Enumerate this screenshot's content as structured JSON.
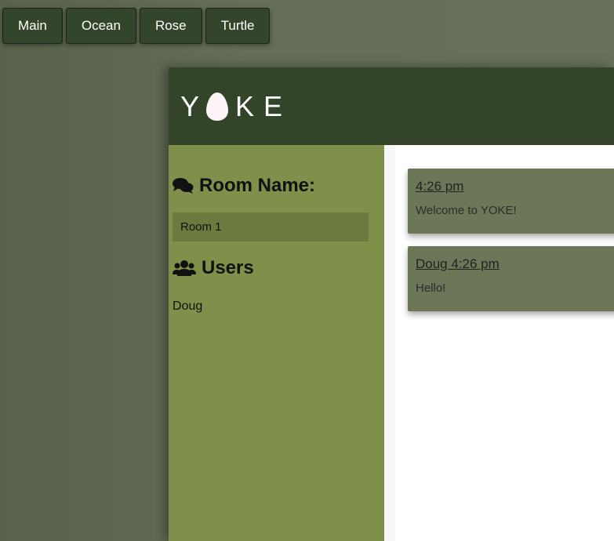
{
  "theme_buttons": [
    "Main",
    "Ocean",
    "Rose",
    "Turtle"
  ],
  "logo": {
    "letters": [
      "Y",
      "K",
      "E"
    ]
  },
  "sidebar": {
    "room_title": "Room Name:",
    "room_input_value": "Room 1",
    "users_title": "Users",
    "users": [
      "Doug"
    ]
  },
  "messages": [
    {
      "meta": "4:26 pm",
      "text": "Welcome to YOKE!"
    },
    {
      "meta": "Doug 4:26 pm",
      "text": "Hello!"
    }
  ],
  "colors": {
    "header": "#334428",
    "sidebar": "#7e9049",
    "message_card": "#6c7758",
    "theme_button": "#33452a"
  },
  "icons": {
    "room": "comments-icon",
    "users": "users-icon",
    "logo_o": "egg-icon"
  }
}
